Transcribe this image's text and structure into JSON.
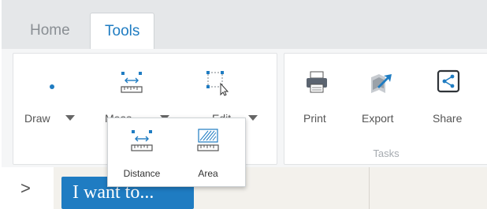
{
  "tabs": [
    {
      "label": "Home",
      "active": false
    },
    {
      "label": "Tools",
      "active": true
    }
  ],
  "tools": {
    "draw": {
      "label": "Draw",
      "icon": "dot-icon"
    },
    "measure": {
      "label": "Meas...",
      "icon": "ruler-icon"
    },
    "edit": {
      "label": "Edit",
      "icon": "select-edit-icon"
    }
  },
  "tasks": {
    "group_label": "Tasks",
    "print": {
      "label": "Print",
      "icon": "printer-icon"
    },
    "export": {
      "label": "Export",
      "icon": "export-icon"
    },
    "share": {
      "label": "Share",
      "icon": "share-icon"
    }
  },
  "measure_menu": [
    {
      "label": "Distance",
      "icon": "distance-ruler-icon"
    },
    {
      "label": "Area",
      "icon": "area-ruler-icon"
    }
  ],
  "sidebar": {
    "expand_icon": ">"
  },
  "i_want_to": {
    "label": "I want to..."
  },
  "colors": {
    "accent": "#1f7cc2",
    "tab_active_text": "#1f7cc2"
  }
}
